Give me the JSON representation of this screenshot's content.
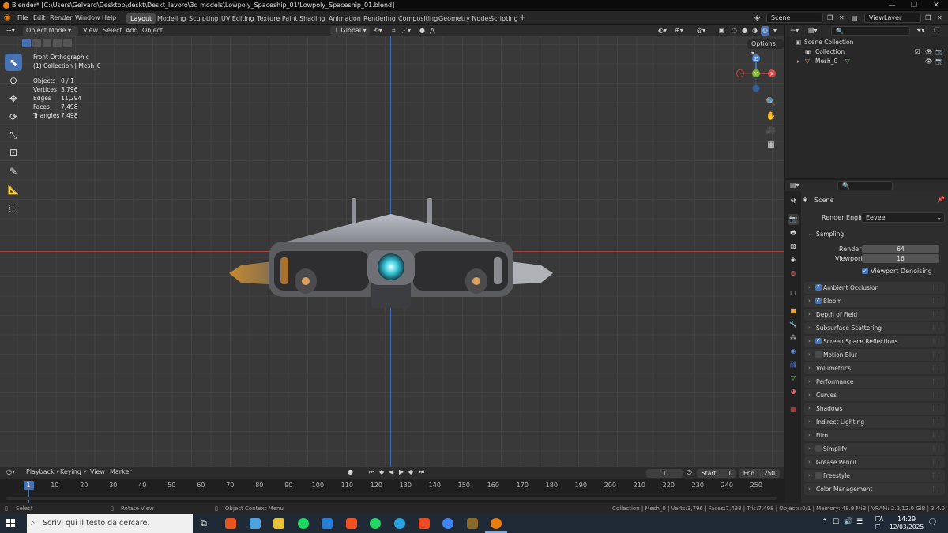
{
  "window": {
    "title": "Blender* [C:\\Users\\Gelvard\\Desktop\\deskt\\Deskt_lavoro\\3d models\\Lowpoly_Spaceship_01\\Lowpoly_Spaceship_01.blend]",
    "minimize": "—",
    "maximize": "❐",
    "close": "✕"
  },
  "menu": [
    "File",
    "Edit",
    "Render",
    "Window",
    "Help"
  ],
  "workspaces": [
    "Layout",
    "Modeling",
    "Sculpting",
    "UV Editing",
    "Texture Paint",
    "Shading",
    "Animation",
    "Rendering",
    "Compositing",
    "Geometry Nodes",
    "Scripting"
  ],
  "workspace_add": "+",
  "scene_field": "Scene",
  "viewlayer_field": "ViewLayer",
  "viewport_header": {
    "mode": "Object Mode",
    "menus": [
      "View",
      "Select",
      "Add",
      "Object"
    ],
    "orientation": "Global",
    "options": "Options"
  },
  "viewport_overlay": {
    "view_name": "Front Orthographic",
    "collection_line": "(1) Collection | Mesh_0",
    "stats": [
      {
        "label": "Objects",
        "value": "0 / 1"
      },
      {
        "label": "Vertices",
        "value": "3,796"
      },
      {
        "label": "Edges",
        "value": "11,294"
      },
      {
        "label": "Faces",
        "value": "7,498"
      },
      {
        "label": "Triangles",
        "value": "7,498"
      }
    ]
  },
  "gizmo": {
    "z": "Z",
    "x": "X",
    "y": "Y"
  },
  "timeline_header": {
    "menus": [
      "Playback",
      "Keying",
      "View",
      "Marker"
    ],
    "current_frame": "1",
    "start_label": "Start",
    "start_value": "1",
    "end_label": "End",
    "end_value": "250"
  },
  "timeline_ticks": [
    "1",
    "10",
    "20",
    "30",
    "40",
    "50",
    "60",
    "70",
    "80",
    "90",
    "100",
    "110",
    "120",
    "130",
    "140",
    "150",
    "160",
    "170",
    "180",
    "190",
    "200",
    "210",
    "220",
    "230",
    "240",
    "250"
  ],
  "statusbar": {
    "select": "Select",
    "rotate": "Rotate View",
    "context": "Object Context Menu",
    "info": "Collection | Mesh_0 | Verts:3,796 | Faces:7,498 | Tris:7,498 | Objects:0/1 | Memory: 48.9 MiB | VRAM: 2.2/12.0 GiB | 3.4.0"
  },
  "outliner": {
    "scene_collection": "Scene Collection",
    "collection": "Collection",
    "mesh": "Mesh_0"
  },
  "properties": {
    "context": "Scene",
    "render_engine_label": "Render Engine",
    "render_engine": "Eevee",
    "sampling": {
      "title": "Sampling",
      "render_label": "Render",
      "render_value": "64",
      "viewport_label": "Viewport",
      "viewport_value": "16",
      "denoise_label": "Viewport Denoising"
    },
    "panels": [
      {
        "label": "Ambient Occlusion",
        "checkbox": true,
        "checked": true
      },
      {
        "label": "Bloom",
        "checkbox": true,
        "checked": true
      },
      {
        "label": "Depth of Field",
        "checkbox": false,
        "checked": false
      },
      {
        "label": "Subsurface Scattering",
        "checkbox": false,
        "checked": false
      },
      {
        "label": "Screen Space Reflections",
        "checkbox": true,
        "checked": true
      },
      {
        "label": "Motion Blur",
        "checkbox": true,
        "checked": false
      },
      {
        "label": "Volumetrics",
        "checkbox": false,
        "checked": false
      },
      {
        "label": "Performance",
        "checkbox": false,
        "checked": false
      },
      {
        "label": "Curves",
        "checkbox": false,
        "checked": false
      },
      {
        "label": "Shadows",
        "checkbox": false,
        "checked": false
      },
      {
        "label": "Indirect Lighting",
        "checkbox": false,
        "checked": false
      },
      {
        "label": "Film",
        "checkbox": false,
        "checked": false
      },
      {
        "label": "Simplify",
        "checkbox": true,
        "checked": false
      },
      {
        "label": "Grease Pencil",
        "checkbox": false,
        "checked": false
      },
      {
        "label": "Freestyle",
        "checkbox": true,
        "checked": false
      },
      {
        "label": "Color Management",
        "checkbox": false,
        "checked": false
      }
    ]
  },
  "taskbar": {
    "search_placeholder": "Scrivi qui il testo da cercare.",
    "lang_top": "ITA",
    "lang_bottom": "IT",
    "time": "14:29",
    "date": "12/03/2025"
  },
  "colors": {
    "accent": "#4772b3",
    "blender_orange": "#e87d0d"
  }
}
